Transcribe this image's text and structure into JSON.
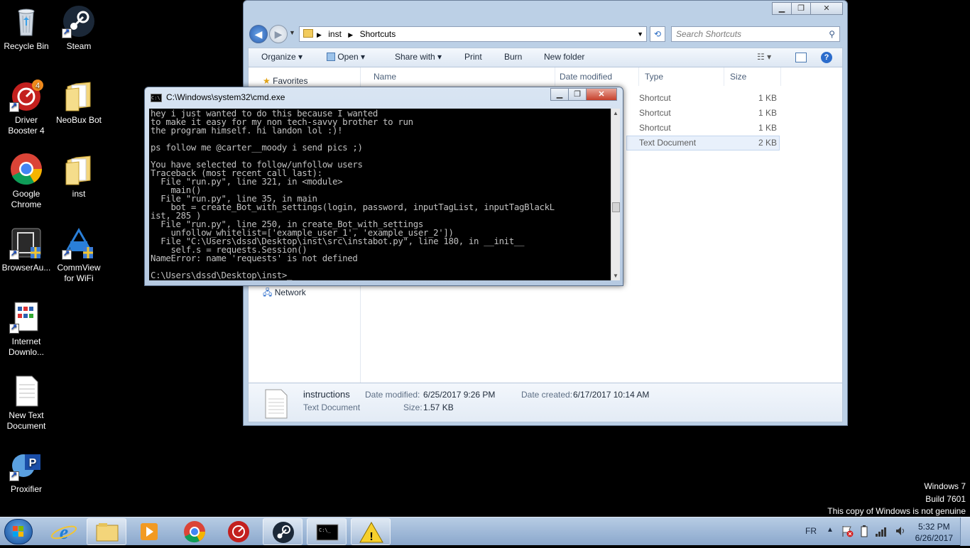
{
  "desktop_icons": [
    {
      "label": "Recycle Bin"
    },
    {
      "label": "Steam"
    },
    {
      "label": "Driver Booster 4",
      "badge": "4"
    },
    {
      "label": "NeoBux Bot"
    },
    {
      "label": "Google Chrome"
    },
    {
      "label": "inst"
    },
    {
      "label": "BrowserAu..."
    },
    {
      "label": "CommView for WiFi"
    },
    {
      "label": "Internet Downlo..."
    },
    {
      "label": "New Text Document"
    },
    {
      "label": "Proxifier"
    }
  ],
  "explorer": {
    "breadcrumb": [
      "inst",
      "Shortcuts"
    ],
    "search_placeholder": "Search Shortcuts",
    "toolbar": {
      "organize": "Organize",
      "open": "Open",
      "share_with": "Share with",
      "print": "Print",
      "burn": "Burn",
      "new_folder": "New folder"
    },
    "nav": {
      "favorites": "Favorites",
      "network": "Network"
    },
    "columns": {
      "name": "Name",
      "date_modified": "Date modified",
      "type": "Type",
      "size": "Size"
    },
    "rows": [
      {
        "type": "Shortcut",
        "size": "1 KB"
      },
      {
        "type": "Shortcut",
        "size": "1 KB"
      },
      {
        "type": "Shortcut",
        "size": "1 KB"
      },
      {
        "type": "Text Document",
        "size": "2 KB"
      }
    ],
    "details": {
      "name": "instructions",
      "kind": "Text Document",
      "date_modified_label": "Date modified:",
      "date_modified": "6/25/2017 9:26 PM",
      "date_created_label": "Date created:",
      "date_created": "6/17/2017 10:14 AM",
      "size_label": "Size:",
      "size": "1.57 KB"
    }
  },
  "cmd": {
    "title": "C:\\Windows\\system32\\cmd.exe",
    "lines": [
      "hey i just wanted to do this because I wanted",
      "to make it easy for my non tech-savvy brother to run",
      "the program himself. hi landon lol :)!",
      "",
      "ps follow me @carter__moody i send pics ;)",
      "",
      "You have selected to follow/unfollow users",
      "Traceback (most recent call last):",
      "  File \"run.py\", line 321, in <module>",
      "    main()",
      "  File \"run.py\", line 35, in main",
      "    bot = create_Bot_with_settings(login, password, inputTagList, inputTagBlackL",
      "ist, 285 )",
      "  File \"run.py\", line 250, in create_Bot_with_settings",
      "    unfollow_whitelist=['example_user_1', 'example_user_2'])",
      "  File \"C:\\Users\\dssd\\Desktop\\inst\\src\\instabot.py\", line 180, in __init__",
      "    self.s = requests.Session()",
      "NameError: name 'requests' is not defined",
      "",
      "C:\\Users\\dssd\\Desktop\\inst>_"
    ]
  },
  "watermark": {
    "line1": "Windows 7",
    "line2": "Build 7601",
    "line3": "This copy of Windows is not genuine"
  },
  "taskbar": {
    "language": "FR",
    "time": "5:32 PM",
    "date": "6/26/2017"
  },
  "colors": {
    "accent": "#2b5fb0",
    "console_bg": "#000000",
    "console_fg": "#c0c0c0",
    "selection": "#e8f0fb"
  }
}
